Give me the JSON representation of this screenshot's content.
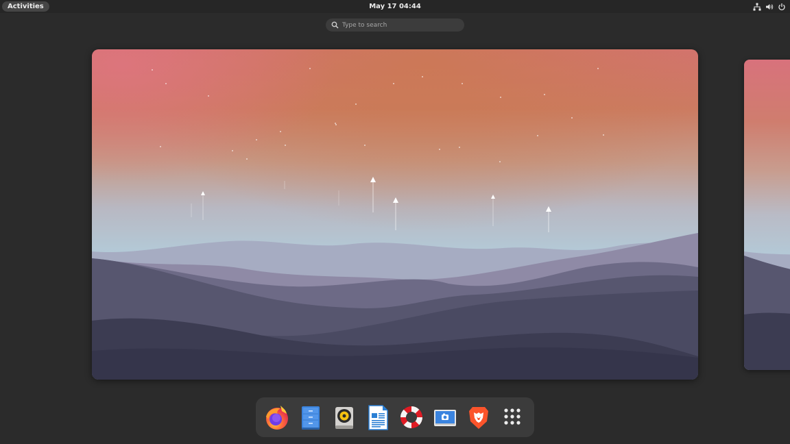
{
  "topbar": {
    "activities_label": "Activities",
    "clock": "May 17  04:44",
    "tray": [
      "network-icon",
      "volume-icon",
      "power-icon"
    ]
  },
  "search": {
    "placeholder": "Type to search"
  },
  "workspaces": [
    {
      "name": "workspace-1",
      "wallpaper": "mountains-sunset"
    },
    {
      "name": "workspace-2",
      "wallpaper": "mountains-sunset"
    }
  ],
  "dock": {
    "items": [
      {
        "name": "firefox",
        "icon": "firefox-icon"
      },
      {
        "name": "files",
        "icon": "files-icon"
      },
      {
        "name": "rhythmbox",
        "icon": "rhythmbox-icon"
      },
      {
        "name": "libreoffice-writer",
        "icon": "writer-icon"
      },
      {
        "name": "help",
        "icon": "help-icon"
      },
      {
        "name": "screenshot",
        "icon": "screenshot-icon"
      },
      {
        "name": "brave",
        "icon": "brave-icon"
      },
      {
        "name": "show-apps",
        "icon": "app-grid-icon"
      }
    ]
  },
  "colors": {
    "panel": "#262626",
    "background": "#2b2b2b",
    "dock": "#3b3b3b",
    "accent": "#3584e4"
  }
}
